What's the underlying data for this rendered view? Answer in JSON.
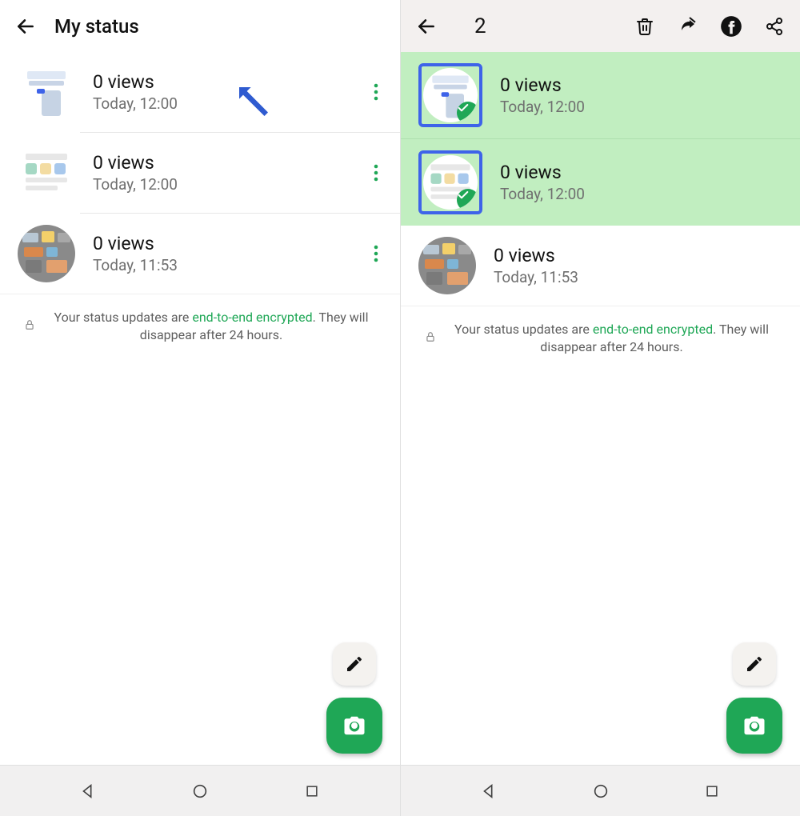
{
  "left": {
    "title": "My status",
    "items": [
      {
        "views": "0 views",
        "time": "Today, 12:00"
      },
      {
        "views": "0 views",
        "time": "Today, 12:00"
      },
      {
        "views": "0 views",
        "time": "Today, 11:53"
      }
    ],
    "note_prefix": "Your status updates are ",
    "note_enc": "end-to-end encrypted",
    "note_suffix": ". They will disappear after 24 hours."
  },
  "right": {
    "selected_count": "2",
    "items": [
      {
        "views": "0 views",
        "time": "Today, 12:00",
        "selected": true
      },
      {
        "views": "0 views",
        "time": "Today, 12:00",
        "selected": true
      },
      {
        "views": "0 views",
        "time": "Today, 11:53",
        "selected": false
      }
    ],
    "note_prefix": "Your status updates are ",
    "note_enc": "end-to-end encrypted",
    "note_suffix": ". They will disappear after 24 hours."
  }
}
